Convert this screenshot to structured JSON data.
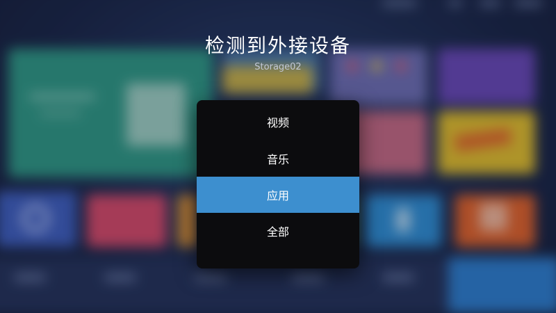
{
  "dialog": {
    "title": "检测到外接设备",
    "device_name": "Storage02",
    "options": [
      {
        "label": "视频",
        "selected": false
      },
      {
        "label": "音乐",
        "selected": false
      },
      {
        "label": "应用",
        "selected": true
      },
      {
        "label": "全部",
        "selected": false
      }
    ],
    "selected_color": "#3d8fcf",
    "panel_color": "#0c0c0e"
  }
}
